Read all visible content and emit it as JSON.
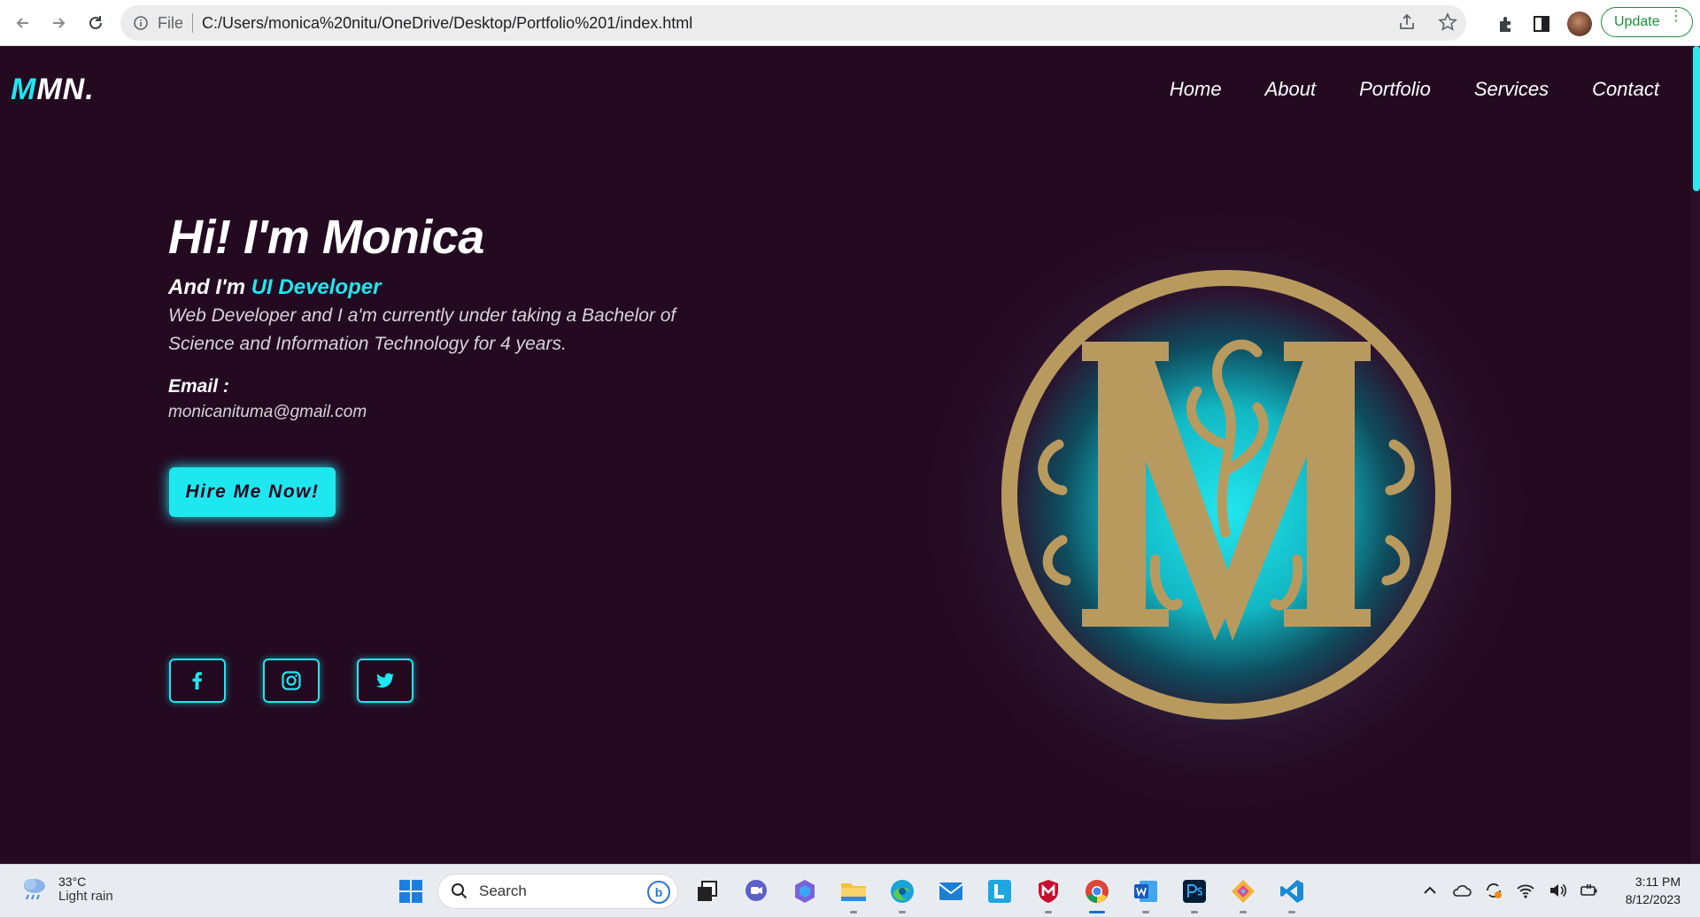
{
  "browser": {
    "scheme_label": "File",
    "url": "C:/Users/monica%20nitu/OneDrive/Desktop/Portfolio%201/index.html",
    "update_label": "Update"
  },
  "site": {
    "logo_accent": "M",
    "logo_rest": "MN.",
    "nav": [
      "Home",
      "About",
      "Portfolio",
      "Services",
      "Contact"
    ],
    "accent_color": "#1fe7f0",
    "background_color": "#230a21"
  },
  "hero": {
    "heading": "Hi! I'm Monica",
    "sub_prefix": "And I'm",
    "role": "UI Developer",
    "description": "Web Developer and I a'm currently under taking a Bachelor of Science and Information Technology for 4 years.",
    "email_label": "Email :",
    "email_value": "monicanituma@gmail.com",
    "cta": "Hire Me Now!"
  },
  "socials": [
    "facebook-icon",
    "instagram-icon",
    "twitter-icon"
  ],
  "taskbar": {
    "weather_temp": "33°C",
    "weather_cond": "Light rain",
    "search_label": "Search",
    "time": "3:11 PM",
    "date": "8/12/2023"
  }
}
